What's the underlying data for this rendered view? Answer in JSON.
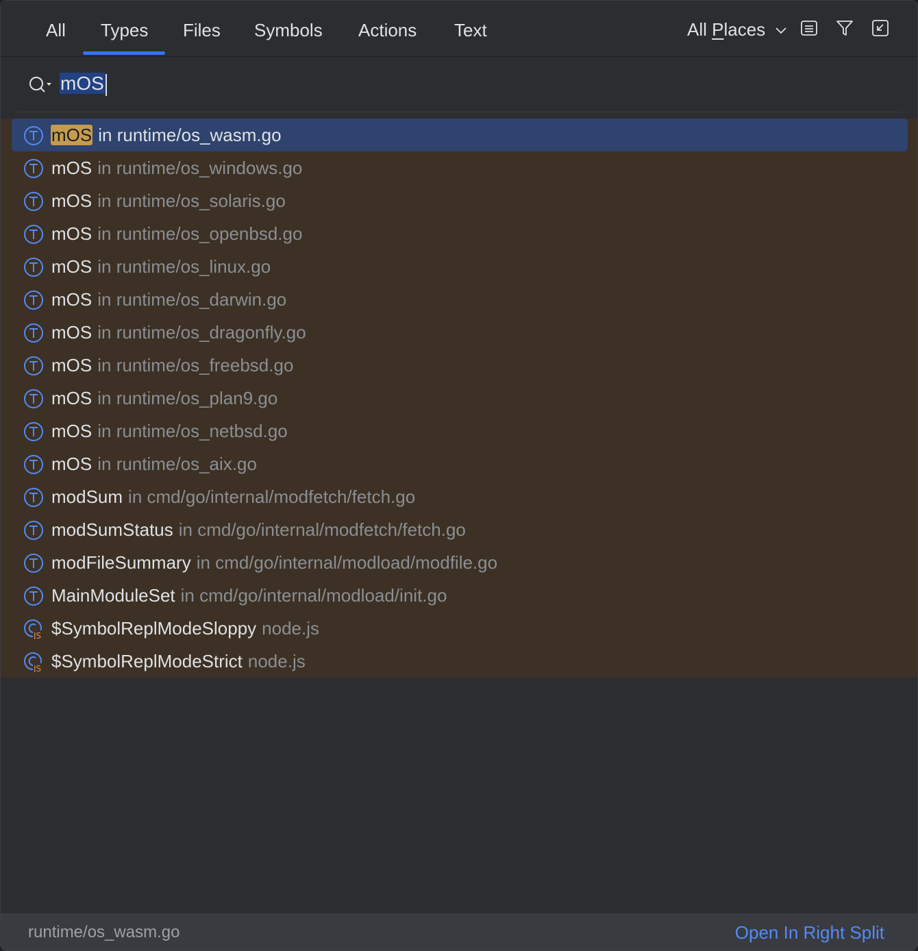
{
  "tabs": [
    {
      "label": "All"
    },
    {
      "label": "Types"
    },
    {
      "label": "Files"
    },
    {
      "label": "Symbols"
    },
    {
      "label": "Actions"
    },
    {
      "label": "Text"
    }
  ],
  "active_tab": "Types",
  "scope": {
    "prefix": "All ",
    "underlined": "P",
    "suffix": "laces"
  },
  "search": {
    "query": "mOS"
  },
  "results": [
    {
      "name": "mOS",
      "location": "in runtime/os_wasm.go",
      "kind": "type"
    },
    {
      "name": "mOS",
      "location": "in runtime/os_windows.go",
      "kind": "type"
    },
    {
      "name": "mOS",
      "location": "in runtime/os_solaris.go",
      "kind": "type"
    },
    {
      "name": "mOS",
      "location": "in runtime/os_openbsd.go",
      "kind": "type"
    },
    {
      "name": "mOS",
      "location": "in runtime/os_linux.go",
      "kind": "type"
    },
    {
      "name": "mOS",
      "location": "in runtime/os_darwin.go",
      "kind": "type"
    },
    {
      "name": "mOS",
      "location": "in runtime/os_dragonfly.go",
      "kind": "type"
    },
    {
      "name": "mOS",
      "location": "in runtime/os_freebsd.go",
      "kind": "type"
    },
    {
      "name": "mOS",
      "location": "in runtime/os_plan9.go",
      "kind": "type"
    },
    {
      "name": "mOS",
      "location": "in runtime/os_netbsd.go",
      "kind": "type"
    },
    {
      "name": "mOS",
      "location": "in runtime/os_aix.go",
      "kind": "type"
    },
    {
      "name": "modSum",
      "location": "in cmd/go/internal/modfetch/fetch.go",
      "kind": "type"
    },
    {
      "name": "modSumStatus",
      "location": "in cmd/go/internal/modfetch/fetch.go",
      "kind": "type"
    },
    {
      "name": "modFileSummary",
      "location": "in cmd/go/internal/modload/modfile.go",
      "kind": "type"
    },
    {
      "name": "MainModuleSet",
      "location": "in cmd/go/internal/modload/init.go",
      "kind": "type"
    },
    {
      "name": "$SymbolReplModeSloppy",
      "location": "node.js",
      "kind": "js-class"
    },
    {
      "name": "$SymbolReplModeStrict",
      "location": "node.js",
      "kind": "js-class"
    }
  ],
  "footer": {
    "path": "runtime/os_wasm.go",
    "action": "Open In Right Split"
  },
  "colors": {
    "accent": "#3574f0",
    "selection": "#2e436e",
    "match_highlight": "#c59b4f",
    "results_bg": "#3c3124",
    "link": "#548af7"
  }
}
